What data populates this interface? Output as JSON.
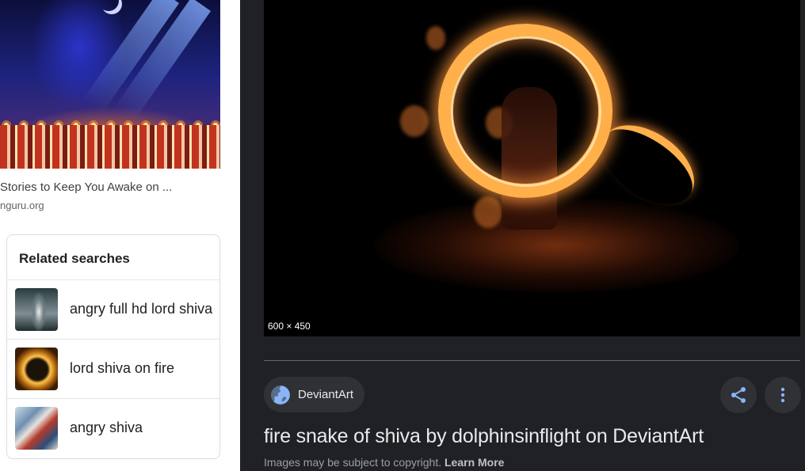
{
  "left_result": {
    "title": "Stories to Keep You Awake on ...",
    "source": "nguru.org"
  },
  "related": {
    "heading": "Related searches",
    "items": [
      {
        "label": "angry full hd lord shiva"
      },
      {
        "label": "lord shiva on fire"
      },
      {
        "label": "angry shiva"
      }
    ]
  },
  "preview": {
    "dimensions": "600 × 450",
    "site_name": "DeviantArt",
    "site_icon": "globe-icon",
    "title": "fire snake of shiva by dolphinsinflight on DeviantArt",
    "copyright_text": "Images may be subject to copyright.",
    "learn_more": "Learn More"
  },
  "actions": {
    "share_icon": "share-icon",
    "more_icon": "more-vert-icon"
  },
  "colors": {
    "panel_bg": "#202124",
    "chip_bg": "#303134",
    "accent_blue": "#8ab4f8",
    "title_text": "#e8eaed"
  }
}
